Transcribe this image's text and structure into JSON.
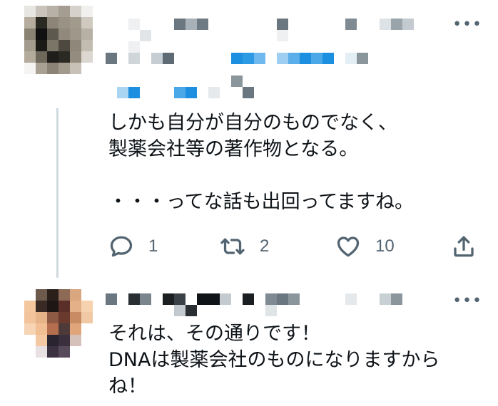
{
  "tweet1": {
    "text": "しかも自分が自分のものでなく、\n製薬会社等の著作物となる。\n\n・・・ってな話も出回ってますね。",
    "reply_count": "1",
    "retweet_count": "2",
    "like_count": "10",
    "more_icon": "•••"
  },
  "tweet2": {
    "text": "それは、その通りです！\nDNAは製薬会社のものになりますから\nね！",
    "more_icon": "•••"
  },
  "colors": {
    "text": "#0f1419",
    "muted": "#536471",
    "thread_line": "#cfd9de",
    "link_blue": "#1d9bf0"
  }
}
